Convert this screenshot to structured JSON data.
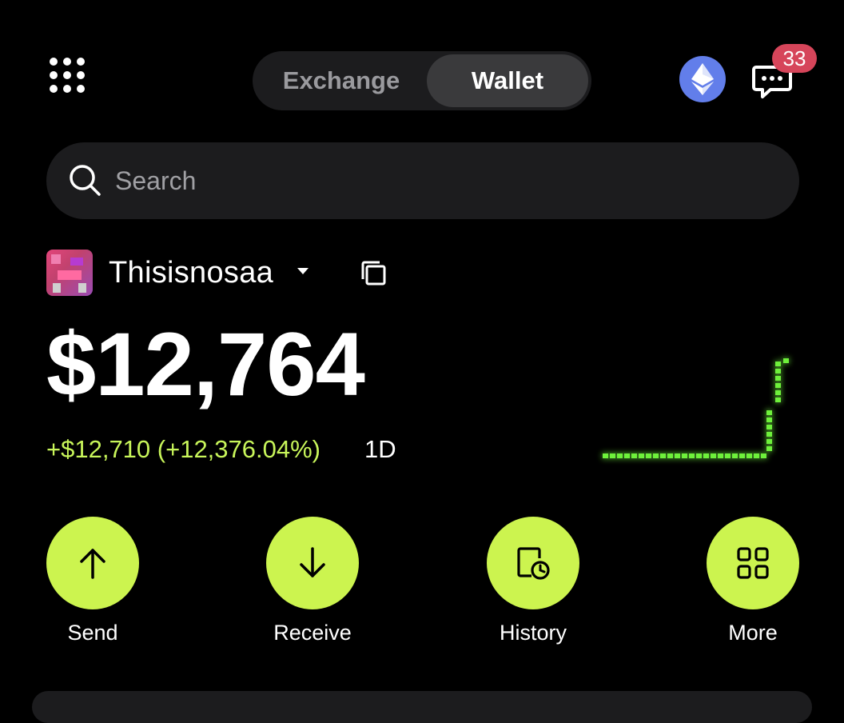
{
  "header": {
    "tabs": [
      {
        "label": "Exchange",
        "active": false
      },
      {
        "label": "Wallet",
        "active": true
      }
    ],
    "network_icon": "ethereum-icon",
    "notification_count": "33"
  },
  "search": {
    "placeholder": "Search"
  },
  "account": {
    "name": "Thisisnosaa"
  },
  "portfolio": {
    "balance": "$12,764",
    "change": "+$12,710 (+12,376.04%)",
    "period": "1D"
  },
  "actions": [
    {
      "label": "Send",
      "icon": "arrow-up-icon"
    },
    {
      "label": "Receive",
      "icon": "arrow-down-icon"
    },
    {
      "label": "History",
      "icon": "history-icon"
    },
    {
      "label": "More",
      "icon": "grid-icon"
    }
  ],
  "colors": {
    "accent": "#ccf44f",
    "positive": "#c8f55a",
    "badge": "#d6455a",
    "ethereum": "#627eea",
    "surface": "#1c1c1e",
    "sparkline": "#6ef03a"
  }
}
